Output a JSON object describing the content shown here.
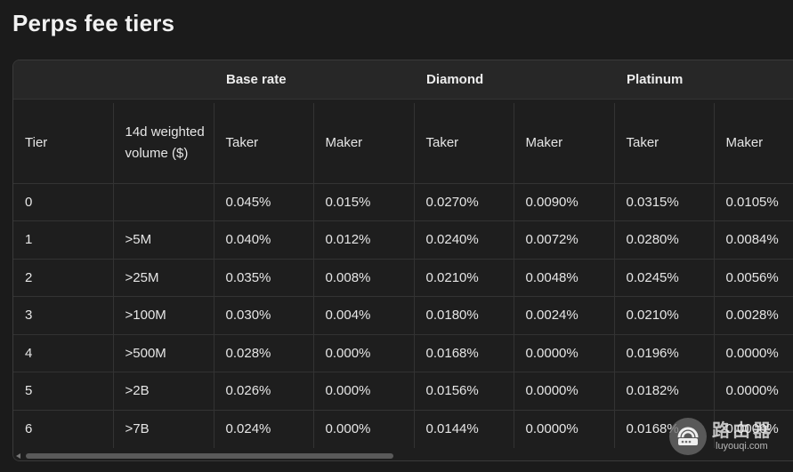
{
  "page": {
    "title": "Perps fee tiers"
  },
  "table": {
    "groups": [
      "Base rate",
      "Diamond",
      "Platinum"
    ],
    "headers": [
      "Tier",
      "14d weighted volume ($)",
      "Taker",
      "Maker",
      "Taker",
      "Maker",
      "Taker",
      "Maker"
    ],
    "rows": [
      [
        "0",
        "",
        "0.045%",
        "0.015%",
        "0.0270%",
        "0.0090%",
        "0.0315%",
        "0.0105%"
      ],
      [
        "1",
        ">5M",
        "0.040%",
        "0.012%",
        "0.0240%",
        "0.0072%",
        "0.0280%",
        "0.0084%"
      ],
      [
        "2",
        ">25M",
        "0.035%",
        "0.008%",
        "0.0210%",
        "0.0048%",
        "0.0245%",
        "0.0056%"
      ],
      [
        "3",
        ">100M",
        "0.030%",
        "0.004%",
        "0.0180%",
        "0.0024%",
        "0.0210%",
        "0.0028%"
      ],
      [
        "4",
        ">500M",
        "0.028%",
        "0.000%",
        "0.0168%",
        "0.0000%",
        "0.0196%",
        "0.0000%"
      ],
      [
        "5",
        ">2B",
        "0.026%",
        "0.000%",
        "0.0156%",
        "0.0000%",
        "0.0182%",
        "0.0000%"
      ],
      [
        "6",
        ">7B",
        "0.024%",
        "0.000%",
        "0.0144%",
        "0.0000%",
        "0.0168%",
        "0.0000%"
      ]
    ]
  },
  "watermark": {
    "title": "路由器",
    "subtitle": "luyouqi.com",
    "icon": "router-icon"
  },
  "colors": {
    "background": "#1b1b1b",
    "header_band": "#272727",
    "border": "#333333",
    "text": "#e6e6e6"
  }
}
